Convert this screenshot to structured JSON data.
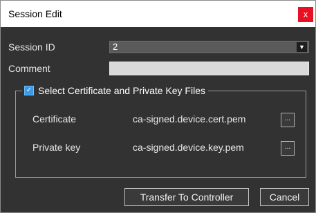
{
  "window": {
    "title": "Session Edit",
    "close_glyph": "x"
  },
  "form": {
    "session_id_label": "Session ID",
    "session_id_value": "2",
    "comment_label": "Comment",
    "comment_value": ""
  },
  "files_group": {
    "checkbox_label": "Select Certificate and Private Key Files",
    "checked": true,
    "certificate_label": "Certificate",
    "certificate_value": "ca-signed.device.cert.pem",
    "private_key_label": "Private key",
    "private_key_value": "ca-signed.device.key.pem",
    "browse_label": "..."
  },
  "buttons": {
    "transfer_label": "Transfer To Controller",
    "cancel_label": "Cancel"
  },
  "colors": {
    "background": "#323232",
    "close_button": "#e81123",
    "checkbox": "#3b9be8"
  }
}
